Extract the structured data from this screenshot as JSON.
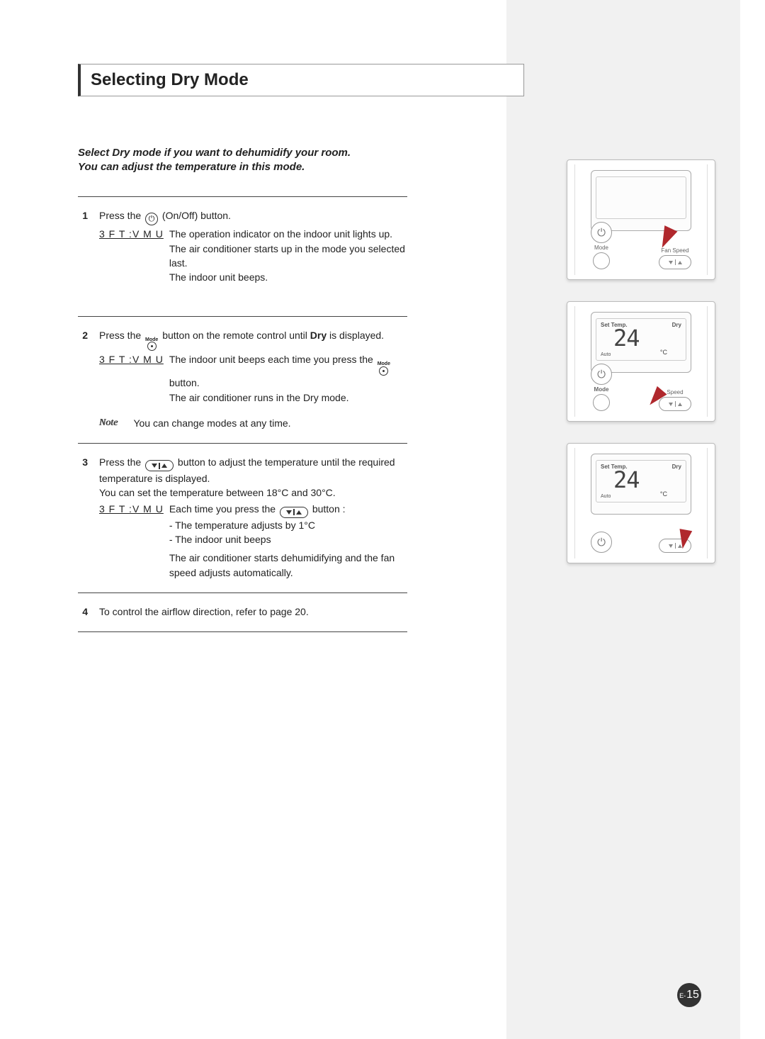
{
  "title": "Selecting Dry Mode",
  "intro_line1": "Select Dry mode if you want to dehumidify your room.",
  "intro_line2": "You can adjust the temperature in this mode.",
  "result_label": "3 F T :V M U",
  "step1": {
    "press_a": "Press the",
    "press_b": "(On/Off) button.",
    "r1": "The operation indicator on the indoor unit lights up.",
    "r2": "The air conditioner starts up in the mode you selected last.",
    "r3": "The indoor unit beeps."
  },
  "step2": {
    "press_a": "Press the",
    "press_b": "button on the remote control until",
    "press_c": "Dry",
    "press_d": "is displayed.",
    "r1a": "The indoor unit beeps each time you press the",
    "r1b": "button.",
    "r2": "The air conditioner runs in the Dry mode.",
    "note_label": "Note",
    "note_text": "You can change modes at any time."
  },
  "step3": {
    "press_a": "Press the",
    "press_b": "button to adjust the temperature until the required temperature is displayed.",
    "range": "You can set the temperature between 18°C and 30°C.",
    "r1a": "Each time you press the",
    "r1b": "button :",
    "r2": "- The temperature adjusts by 1°C",
    "r3": "- The indoor unit beeps",
    "r4": "The air conditioner starts dehumidifying and the fan speed adjusts automatically."
  },
  "step4": {
    "text": "To control the airflow direction, refer to page 20."
  },
  "remote": {
    "mode_label": "Mode",
    "fanspeed_label": "Fan Speed",
    "speed_label": "Speed",
    "settemp": "Set Temp.",
    "dry": "Dry",
    "auto": "Auto",
    "temp": "24",
    "unit": "°C",
    "mode_icon_label": "Mode"
  },
  "page_prefix": "E-",
  "page_number": "15",
  "icons": {
    "power": "⏻",
    "mode": "Mode"
  }
}
